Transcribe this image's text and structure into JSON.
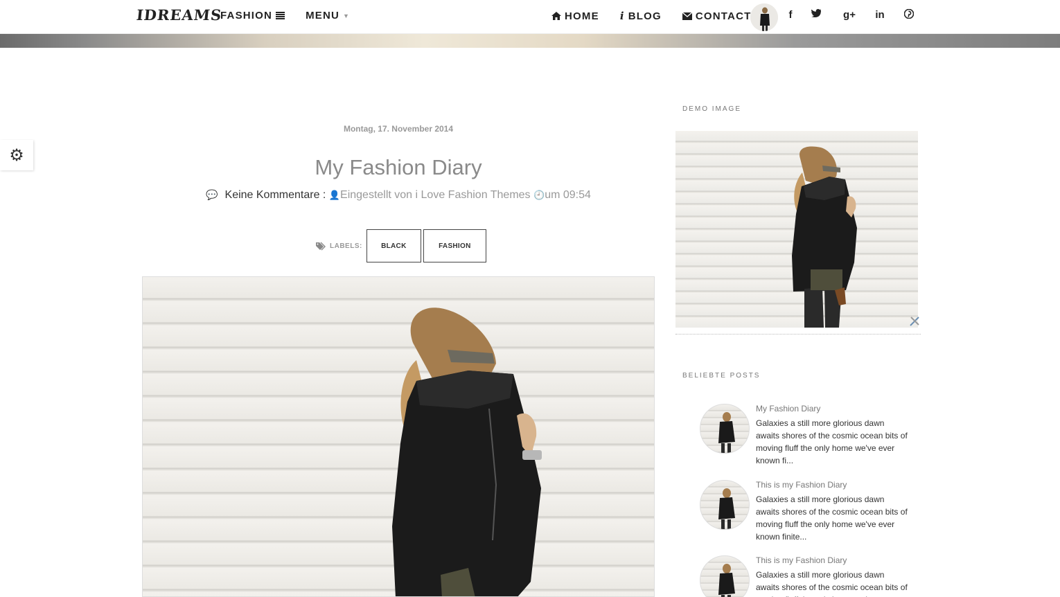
{
  "nav": {
    "logo": "IDREAMS",
    "fashion_label": "FASHION",
    "menu_label": "MENU",
    "home_label": "HOME",
    "blog_label": "BLOG",
    "contact_label": "CONTACT",
    "social": {
      "facebook": "f",
      "twitter": "twitter-icon",
      "googleplus": "g+",
      "linkedin": "in",
      "pinterest": "pinterest-icon"
    }
  },
  "post": {
    "date": "Montag, 17. November 2014",
    "title": "My Fashion Diary",
    "comments": "Keine Kommentare :",
    "author": "Eingestellt von i Love Fashion Themes",
    "time": "um 09:54",
    "labels_label": "LABELS:",
    "labels": [
      "BLACK",
      "FASHION"
    ]
  },
  "sidebar": {
    "demo_title": "DEMO IMAGE",
    "popular_title": "BELIEBTE POSTS",
    "popular": [
      {
        "title": "My Fashion Diary",
        "snippet": "Galaxies a still more glorious dawn awaits shores of the cosmic ocean bits of moving fluff the only home we've ever known fi..."
      },
      {
        "title": "This is my Fashion Diary",
        "snippet": "Galaxies a still more glorious dawn awaits shores of the cosmic ocean bits of moving fluff the only home we've ever known finite..."
      },
      {
        "title": "This is my Fashion Diary",
        "snippet": "Galaxies a still more glorious dawn awaits shores of the cosmic ocean bits of moving fluff the only home we've ever known finite..."
      }
    ]
  },
  "colors": {
    "accent": "#222222",
    "muted": "#999999"
  }
}
